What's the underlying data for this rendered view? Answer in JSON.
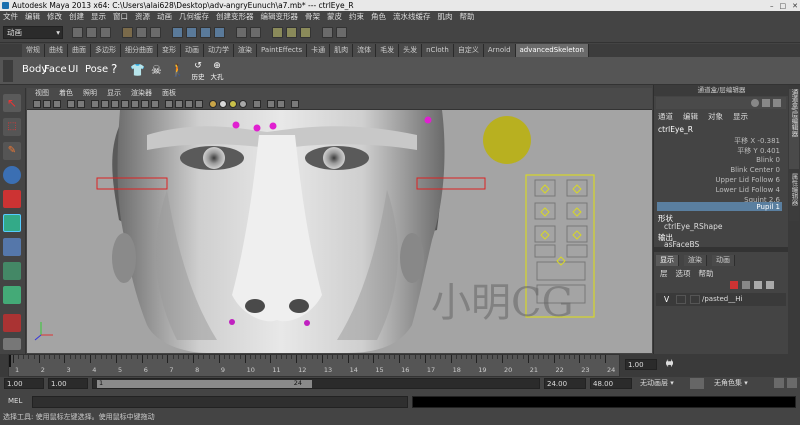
{
  "window": {
    "title": "Autodesk Maya 2013 x64: C:\\Users\\alai628\\Desktop\\adv-angryEunuch\\a7.mb*   ---   ctrlEye_R",
    "controls": [
      "–",
      "□",
      "✕"
    ]
  },
  "menubar": [
    "文件",
    "编辑",
    "修改",
    "创建",
    "显示",
    "窗口",
    "资源",
    "动画",
    "几何缓存",
    "创建变形器",
    "编辑变形器",
    "骨架",
    "蒙皮",
    "约束",
    "角色",
    "流水线缓存",
    "肌肉",
    "帮助"
  ],
  "mode_dropdown": "动画",
  "shelf_tabs": [
    "常规",
    "曲线",
    "曲面",
    "多边形",
    "细分曲面",
    "变形",
    "动画",
    "动力学",
    "渲染",
    "PaintEffects",
    "卡通",
    "肌肉",
    "流体",
    "毛发",
    "头发",
    "nCloth",
    "自定义",
    "Arnold",
    "advancedSkeleton"
  ],
  "shelf_active_tab": "advancedSkeleton",
  "shelf_buttons": {
    "body": "Body",
    "face": "Face",
    "ui": "UI",
    "pose": "Pose",
    "help": "?",
    "history_label": "历史",
    "size_label": "大孔"
  },
  "panel_menu": [
    "视图",
    "着色",
    "照明",
    "显示",
    "渲染器",
    "面板"
  ],
  "viewport": {
    "watermark": "小明CG"
  },
  "channel_box": {
    "header": "通道盒/层编辑器",
    "menu": [
      "通道",
      "编辑",
      "对象",
      "显示"
    ],
    "object": "ctrlEye_R",
    "attrs": [
      {
        "name": "平移 X",
        "value": "-0.381"
      },
      {
        "name": "平移 Y",
        "value": "0.401"
      },
      {
        "name": "Blink",
        "value": "0"
      },
      {
        "name": "Blink Center",
        "value": "0"
      },
      {
        "name": "Upper Lid Follow",
        "value": "6"
      },
      {
        "name": "Lower Lid Follow",
        "value": "4"
      },
      {
        "name": "Squint",
        "value": "2.6"
      },
      {
        "name": "Pupil",
        "value": "1"
      }
    ],
    "shapes_label": "形状",
    "shape_name": "ctrlEye_RShape",
    "outputs_label": "输出",
    "output_name": "asFaceBS"
  },
  "layer_editor": {
    "tabs": [
      "显示",
      "渲染",
      "动画"
    ],
    "menu": [
      "层",
      "选项",
      "帮助"
    ],
    "layer_v": "V",
    "layer_name": "/pasted__Hi"
  },
  "side_tabs": [
    "通道盒/层编辑器",
    "属性编辑器"
  ],
  "timeline": {
    "ticks": [
      "1",
      "2",
      "3",
      "4",
      "5",
      "6",
      "7",
      "8",
      "9",
      "10",
      "11",
      "12",
      "13",
      "14",
      "15",
      "16",
      "17",
      "18",
      "19",
      "20",
      "21",
      "22",
      "23",
      "24"
    ],
    "current": "1.00"
  },
  "range": {
    "start": "1.00",
    "start2": "1.00",
    "slider_start": "1",
    "slider_end": "24",
    "end": "24.00",
    "end2": "48.00",
    "anim_layer": "无动画层",
    "char_set": "无角色集"
  },
  "mel": {
    "label": "MEL"
  },
  "help_line": "选择工具: 使用鼠标左键选择。使用鼠标中键拖动"
}
